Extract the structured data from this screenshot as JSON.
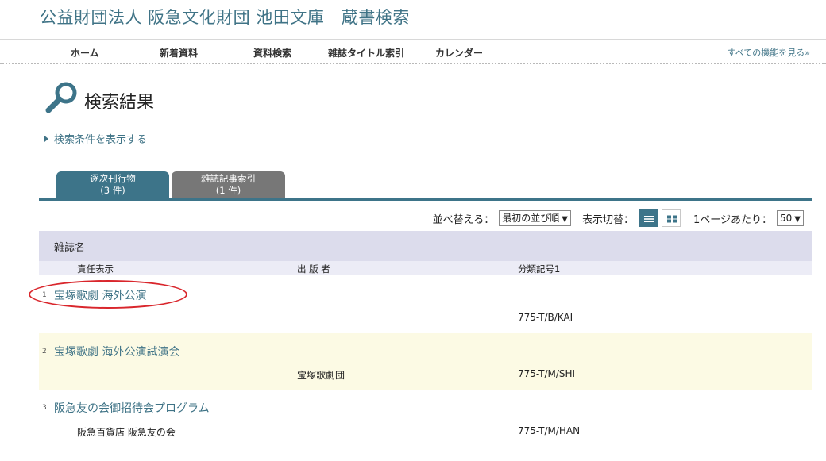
{
  "site": {
    "title": "公益財団法人 阪急文化財団 池田文庫　蔵書検索"
  },
  "nav": {
    "items": [
      "ホーム",
      "新着資料",
      "資料検索",
      "雑誌タイトル索引",
      "カレンダー"
    ],
    "more_label": "すべての機能を見る»"
  },
  "page": {
    "title": "検索結果",
    "toggle_conditions": "検索条件を表示する"
  },
  "tabs": [
    {
      "label": "逐次刊行物",
      "count": "(3 件)"
    },
    {
      "label": "雑誌記事索引",
      "count": "(1 件)"
    }
  ],
  "toolbar": {
    "sort_label": "並べ替える：",
    "sort_value": "最初の並び順",
    "view_label": "表示切替：",
    "per_page_label": "1ページあたり：",
    "per_page_value": "50"
  },
  "columns": {
    "title": "雑誌名",
    "responsibility": "責任表示",
    "publisher": "出 版 者",
    "classification": "分類記号1"
  },
  "results": [
    {
      "num": "1",
      "title": "宝塚歌劇 海外公演",
      "responsibility": "",
      "publisher": "",
      "classification": "775-T/B/KAI"
    },
    {
      "num": "2",
      "title": "宝塚歌劇 海外公演試演会",
      "responsibility": "",
      "publisher": "宝塚歌劇団",
      "classification": "775-T/M/SHI"
    },
    {
      "num": "3",
      "title": "阪急友の会御招待会プログラム",
      "responsibility": "阪急百貨店 阪急友の会",
      "publisher": "",
      "classification": "775-T/M/HAN"
    }
  ],
  "colors": {
    "accent": "#3d7489",
    "link": "#3f7386",
    "highlight": "#d9262c",
    "alt_row": "#fcfae4"
  }
}
